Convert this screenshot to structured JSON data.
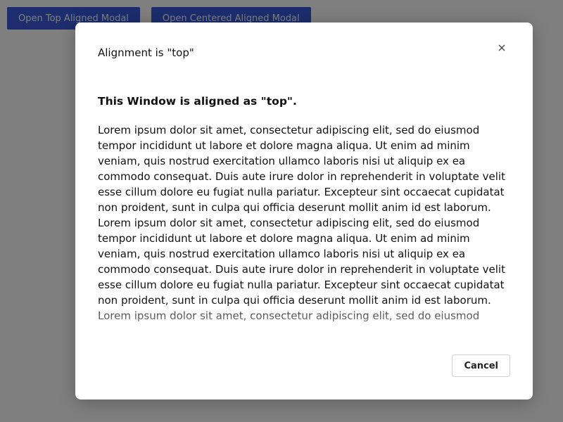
{
  "toolbar": {
    "open_top_label": "Open Top Aligned Modal",
    "open_centered_label": "Open Centered Aligned Modal"
  },
  "modal": {
    "title": "Alignment is \"top\"",
    "close_icon": "close-icon",
    "heading": "This Window is aligned as \"top\".",
    "paragraphs": [
      "Lorem ipsum dolor sit amet, consectetur adipiscing elit, sed do eiusmod tempor incididunt ut labore et dolore magna aliqua. Ut enim ad minim veniam, quis nostrud exercitation ullamco laboris nisi ut aliquip ex ea commodo consequat. Duis aute irure dolor in reprehenderit in voluptate velit esse cillum dolore eu fugiat nulla pariatur. Excepteur sint occaecat cupidatat non proident, sunt in culpa qui officia deserunt mollit anim id est laborum. Lorem ipsum dolor sit amet, consectetur adipiscing elit, sed do eiusmod tempor incididunt ut labore et dolore magna aliqua. Ut enim ad minim veniam, quis nostrud exercitation ullamco laboris nisi ut aliquip ex ea commodo consequat. Duis aute irure dolor in reprehenderit in voluptate velit esse cillum dolore eu fugiat nulla pariatur. Excepteur sint occaecat cupidatat non proident, sunt in culpa qui officia deserunt mollit anim id est laborum. Lorem ipsum dolor sit amet, consectetur adipiscing elit, sed do eiusmod"
    ],
    "cancel_label": "Cancel"
  },
  "colors": {
    "primary": "#3b5bdb",
    "overlay": "#000000"
  }
}
